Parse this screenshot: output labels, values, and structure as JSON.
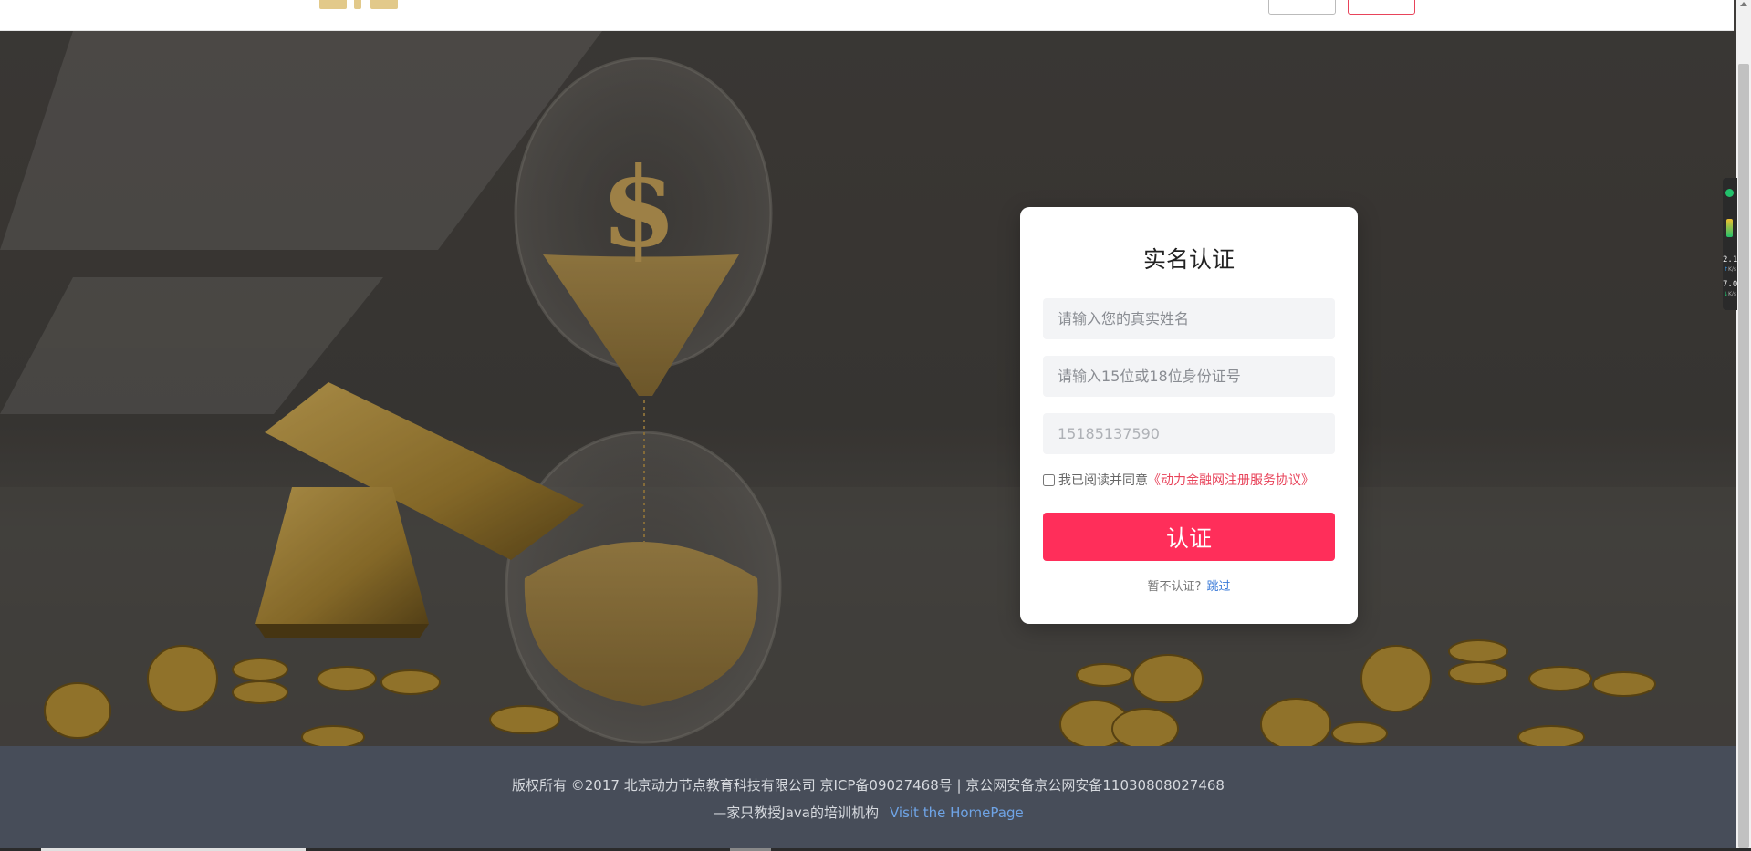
{
  "form": {
    "title": "实名认证",
    "name_placeholder": "请输入您的真实姓名",
    "id_placeholder": "请输入15位或18位身份证号",
    "phone_value": "15185137590",
    "agree_text": "我已阅读并同意",
    "agree_link": "《动力金融网注册服务协议》",
    "submit_label": "认证",
    "skip_text": "暂不认证?",
    "skip_link": "跳过"
  },
  "footer": {
    "copyright": "版权所有 ©2017 北京动力节点教育科技有限公司 京ICP备09027468号 | 京公网安备京公网安备11030808027468",
    "slogan": "—家只教授Java的培训机构",
    "homepage_link": "Visit the HomePage"
  },
  "side_widget": {
    "upload_value": "2.1",
    "upload_unit": "K/s",
    "download_value": "7.0",
    "download_unit": "K/s"
  },
  "colors": {
    "accent": "#ff2e5a",
    "link_red": "#e8435a",
    "link_blue": "#3b7bd8",
    "footer_bg": "#474d59"
  },
  "icons": {
    "upload": "arrow-up-icon",
    "download": "arrow-down-icon"
  }
}
